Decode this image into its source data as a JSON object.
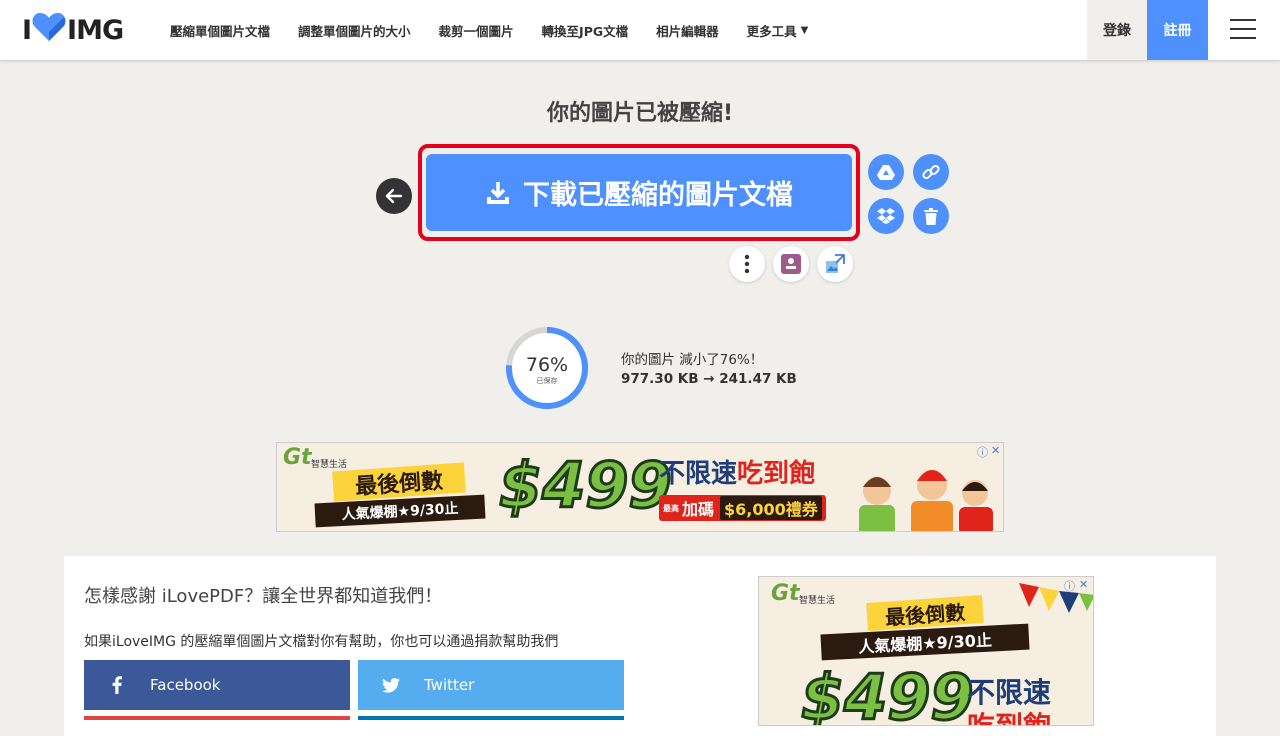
{
  "header": {
    "logo_left": "I",
    "logo_right": "IMG",
    "nav": [
      "壓縮單個圖片文檔",
      "調整單個圖片的大小",
      "裁剪一個圖片",
      "轉換至JPG文檔",
      "相片編輯器"
    ],
    "more": "更多工具",
    "login": "登錄",
    "signup": "註冊"
  },
  "main": {
    "title": "你的圖片已被壓縮!",
    "download_label": "下載已壓縮的圖片文檔",
    "percent": "76%",
    "saved_label": "已保存",
    "saved_fraction": 0.76,
    "stat_text": "你的圖片 減小了76%！",
    "stat_sizes": "977.30 KB → 241.47 KB"
  },
  "ad1": {
    "brand": "Gt",
    "brand_sub": "智慧生活",
    "banner_top": "最後倒數",
    "banner_bottom": "人氣爆棚★9/30止",
    "price": "$499",
    "unlimited": "不限速",
    "eat": "吃到飽",
    "bonus_a": "最高",
    "bonus_b": "加碼",
    "bonus_c": "$6,000禮券"
  },
  "thanks": {
    "title": "怎樣感謝 iLovePDF？讓全世界都知道我們！",
    "text": "如果iLoveIMG 的壓縮單個圖片文檔對你有幫助，你也可以通過捐款幫助我們",
    "facebook": "Facebook",
    "twitter": "Twitter"
  },
  "ad2": {
    "brand": "Gt",
    "brand_sub": "智慧生活",
    "banner_top": "最後倒數",
    "banner_bottom": "人氣爆棚★9/30止",
    "price": "$499",
    "unlimited": "不限速",
    "eat": "吃到飽"
  },
  "colors": {
    "accent": "#4d90fe",
    "highlight_border": "#e5001e",
    "ring_track": "#d6d6d6"
  },
  "icons": [
    "heart-icon",
    "arrow-left-icon",
    "download-icon",
    "google-drive-icon",
    "link-icon",
    "dropbox-icon",
    "trash-icon",
    "more-vertical-icon",
    "pdf-stamp-icon",
    "image-resize-icon",
    "facebook-icon",
    "twitter-icon",
    "ad-info-icon",
    "ad-close-icon",
    "menu-icon"
  ]
}
